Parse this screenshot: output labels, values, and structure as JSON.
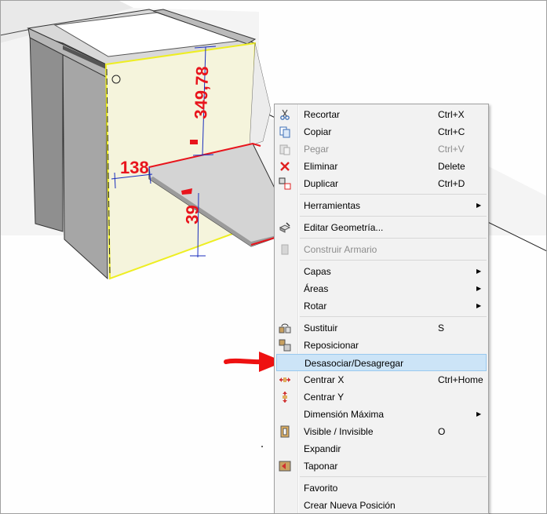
{
  "dimensions": {
    "height_label": "349,78",
    "depth_label": "138",
    "lower_label": "39"
  },
  "context_menu": {
    "items": [
      {
        "label": "Recortar",
        "shortcut": "Ctrl+X",
        "icon": "scissors-icon",
        "enabled": true
      },
      {
        "label": "Copiar",
        "shortcut": "Ctrl+C",
        "icon": "copy-icon",
        "enabled": true
      },
      {
        "label": "Pegar",
        "shortcut": "Ctrl+V",
        "icon": "paste-icon",
        "enabled": false
      },
      {
        "label": "Eliminar",
        "shortcut": "Delete",
        "icon": "delete-x-icon",
        "enabled": true
      },
      {
        "label": "Duplicar",
        "shortcut": "Ctrl+D",
        "icon": "duplicate-icon",
        "enabled": true
      },
      {
        "label": "Herramientas",
        "submenu": true
      },
      {
        "label": "Editar Geometría...",
        "icon": "edit-geometry-icon",
        "enabled": true
      },
      {
        "label": "Construir Armario",
        "icon": "build-cabinet-icon",
        "enabled": false
      },
      {
        "label": "Capas",
        "submenu": true
      },
      {
        "label": "Áreas",
        "submenu": true
      },
      {
        "label": "Rotar",
        "submenu": true
      },
      {
        "label": "Sustituir",
        "shortcut": "S",
        "icon": "substitute-icon",
        "enabled": true
      },
      {
        "label": "Reposicionar",
        "icon": "reposition-icon",
        "enabled": true
      },
      {
        "label": "Desasociar/Desagregar",
        "highlighted": true
      },
      {
        "label": "Centrar X",
        "shortcut": "Ctrl+Home",
        "icon": "center-x-icon",
        "enabled": true
      },
      {
        "label": "Centrar Y",
        "icon": "center-y-icon",
        "enabled": true
      },
      {
        "label": "Dimensión Máxima",
        "submenu": true
      },
      {
        "label": "Visible / Invisible",
        "shortcut": "O",
        "icon": "visibility-icon",
        "enabled": true
      },
      {
        "label": "Expandir",
        "enabled": true
      },
      {
        "label": "Taponar",
        "icon": "plug-icon",
        "enabled": true
      },
      {
        "label": "Favorito",
        "enabled": true
      },
      {
        "label": "Crear Nueva Posición",
        "enabled": true
      }
    ]
  },
  "colors": {
    "highlight": "#cce4f7",
    "dimension": "#e8141c",
    "selection": "#ffff00",
    "panel": "#f5f4dc",
    "arrow": "#ee1111"
  }
}
